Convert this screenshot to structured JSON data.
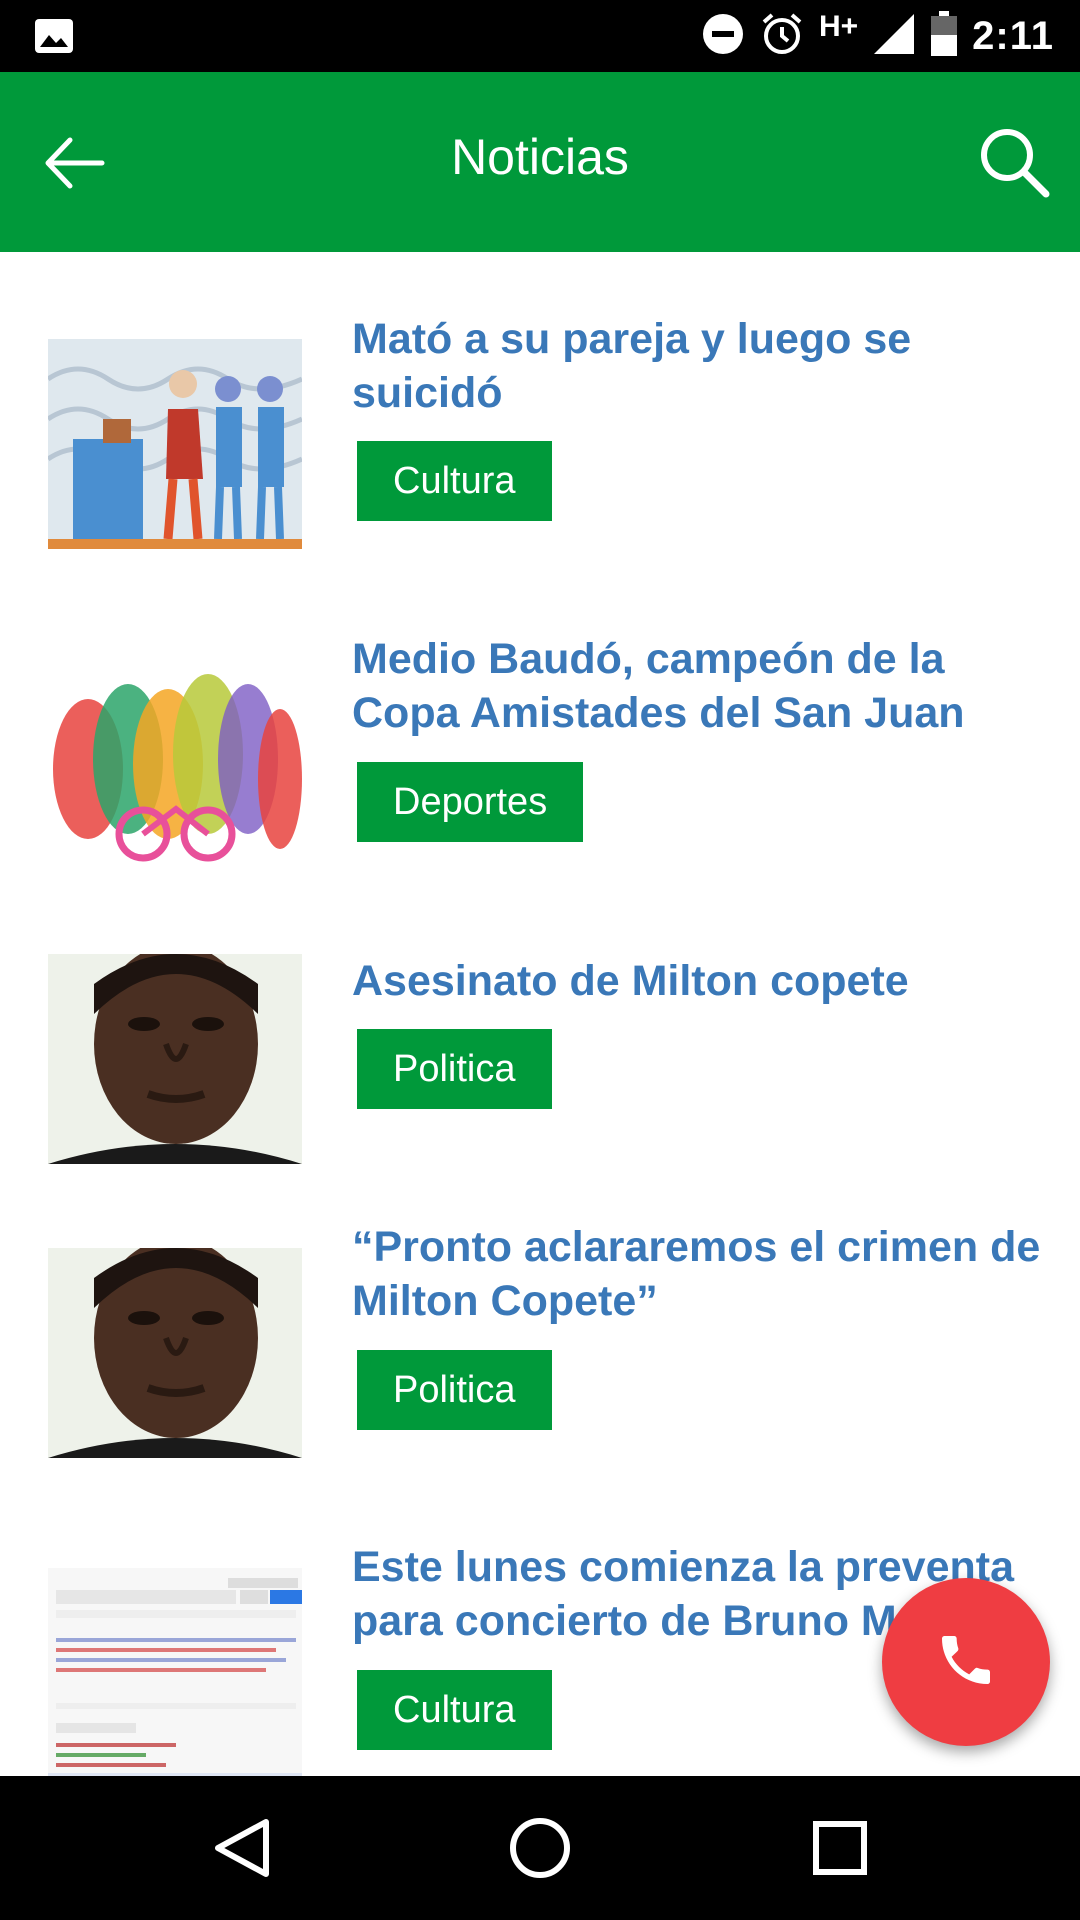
{
  "status_bar": {
    "time": "2:11",
    "network": "H+",
    "icons": [
      "image-icon",
      "do-not-disturb-icon",
      "alarm-icon",
      "signal-icon",
      "battery-icon"
    ]
  },
  "toolbar": {
    "title": "Noticias",
    "back_icon": "arrow-back-icon",
    "search_icon": "search-icon",
    "color": "#00993a"
  },
  "news": [
    {
      "title": "Mató a su pareja y luego se suicidó",
      "category": "Cultura",
      "thumbnail": "illustration-queue"
    },
    {
      "title": "Medio Baudó, campeón de la Copa Amistades del San Juan",
      "category": "Deportes",
      "thumbnail": "illustration-crowd"
    },
    {
      "title": "Asesinato de Milton copete",
      "category": "Politica",
      "thumbnail": "portrait"
    },
    {
      "title": "“Pronto aclararemos el crimen de Milton Copete”",
      "category": "Politica",
      "thumbnail": "portrait"
    },
    {
      "title": "Este lunes comienza la preventa para concierto de Bruno Mars",
      "category": "Cultura",
      "thumbnail": "screenshot"
    }
  ],
  "colors": {
    "title": "#3a78b8",
    "tag": "#00993a",
    "fab": "#ef3d42"
  },
  "fab": {
    "icon": "phone-icon"
  },
  "nav_bar": {
    "icons": [
      "back-triangle-icon",
      "home-circle-icon",
      "recents-square-icon"
    ]
  }
}
